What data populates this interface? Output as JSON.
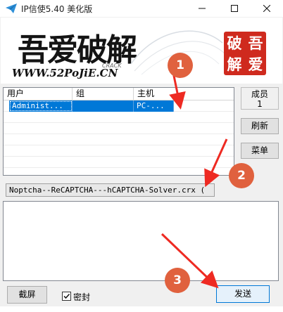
{
  "window": {
    "title": "IP信使5.40 美化版"
  },
  "banner": {
    "logo_text": "吾爱破解",
    "logo_url": "WWW.52PoJiE.CN",
    "logo_tag": "CRACK",
    "seal_chars": [
      "吾",
      "破",
      "爱",
      "解"
    ]
  },
  "listview": {
    "columns": [
      "用户",
      "组",
      "主机"
    ],
    "rows": [
      {
        "user": "Administ...",
        "group": "",
        "host": "PC-..."
      }
    ]
  },
  "side": {
    "members_label": "成员",
    "members_count": "1",
    "refresh_label": "刷新",
    "menu_label": "菜单"
  },
  "file_field": {
    "value": "Noptcha--ReCAPTCHA---hCAPTCHA-Solver.crx ("
  },
  "bottom": {
    "screenshot_label": "截屏",
    "seal_label": "密封",
    "seal_checked": true,
    "send_label": "发送"
  },
  "annotations": {
    "markers": [
      "1",
      "2",
      "3"
    ],
    "color": "#e0613e"
  },
  "colors": {
    "selection": "#0078d7",
    "seal_red": "#cf2a1e"
  }
}
